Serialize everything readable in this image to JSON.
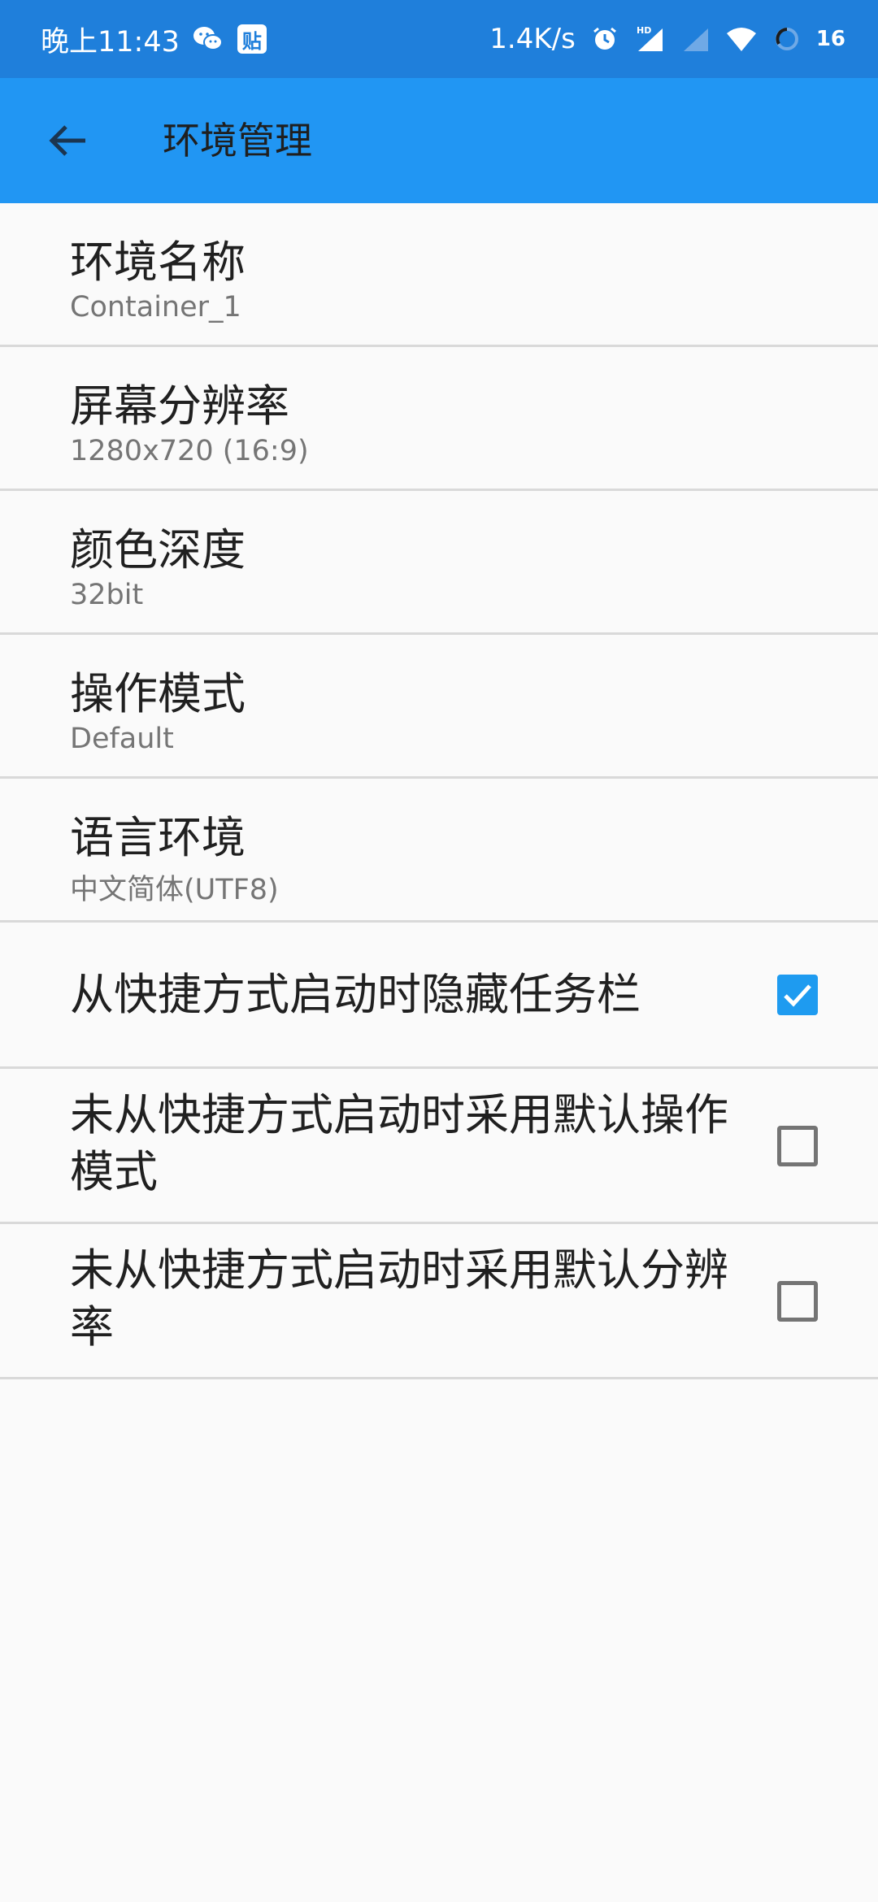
{
  "status_bar": {
    "time": "晚上11:43",
    "tie_app_label": "贴",
    "net_speed": "1.4K/s",
    "battery_level": "16",
    "icons": [
      "wechat-icon",
      "tie-app-icon",
      "alarm-icon",
      "signal-hd-icon",
      "signal-icon",
      "wifi-icon",
      "battery-icon"
    ]
  },
  "app_bar": {
    "title": "环境管理",
    "back_icon": "arrow-back-icon"
  },
  "settings": [
    {
      "title": "环境名称",
      "value": "Container_1"
    },
    {
      "title": "屏幕分辨率",
      "value": "1280x720 (16:9)"
    },
    {
      "title": "颜色深度",
      "value": "32bit"
    },
    {
      "title": "操作模式",
      "value": "Default"
    },
    {
      "title": "语言环境",
      "value": "中文简体(UTF8)"
    }
  ],
  "checkboxes": [
    {
      "label": "从快捷方式启动时隐藏任务栏",
      "checked": true
    },
    {
      "label": "未从快捷方式启动时采用默认操作模式",
      "checked": false
    },
    {
      "label": "未从快捷方式启动时采用默认分辨率",
      "checked": false
    }
  ],
  "colors": {
    "status_bar": "#1f7fdb",
    "app_bar": "#2196f3",
    "checkbox_on": "#1e9bf0",
    "background": "#fafafa"
  }
}
